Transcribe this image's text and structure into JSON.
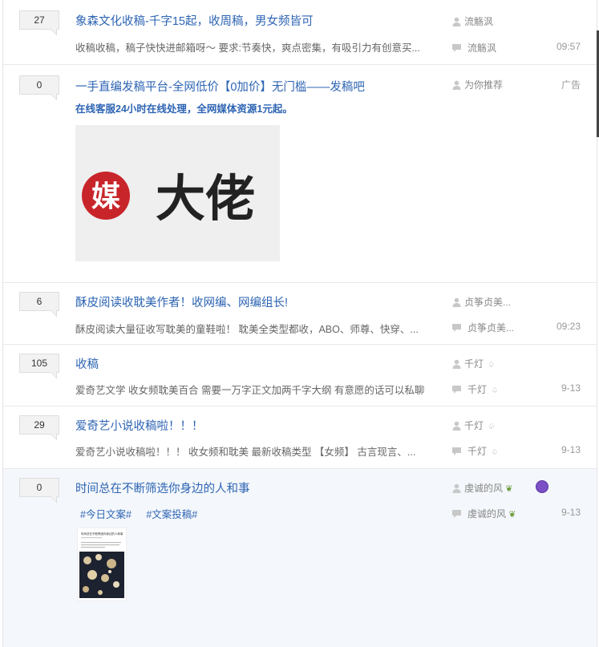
{
  "threads": [
    {
      "count": "27",
      "title": "象森文化收稿-千字15起，收周稿，男女频皆可",
      "abstract": "收稿收稿，稿子快快进邮箱呀～ 要求:节奏快，爽点密集，有吸引力有创意买...",
      "author": "流觞沨",
      "last_reply": "流觞沨",
      "time": "09:57"
    },
    {
      "count": "0",
      "title": "一手直编发稿平台-全网低价【0加价】无门槛——发稿吧",
      "promo": "在线客服24小时在线处理，全网媒体资源1元起。",
      "author": "为你推荐",
      "ad_label": "广告",
      "ad_logo_char": "媒",
      "ad_logo_text": "大佬"
    },
    {
      "count": "6",
      "title": "酥皮阅读收耽美作者！收网编、网编组长!",
      "abstract": "酥皮阅读大量征收写耽美的童鞋啦！ 耽美全类型都收，ABO、师尊、快穿、...",
      "author": "贞筝贞美...",
      "last_reply": "贞筝贞美...",
      "time": "09:23"
    },
    {
      "count": "105",
      "title": "收稿",
      "abstract": "爱奇艺文学 收女频耽美百合 需要一万字正文加两千字大纲 有意愿的话可以私聊",
      "author": "千灯",
      "last_reply": "千灯",
      "time": "9-13"
    },
    {
      "count": "29",
      "title": "爱奇艺小说收稿啦！！！",
      "abstract": "爱奇艺小说收稿啦！！！ 收女频和耽美 最新收稿类型 【女频】 古言现言、...",
      "author": "千灯",
      "last_reply": "千灯",
      "time": "9-13"
    },
    {
      "count": "0",
      "title": "时间总在不断筛选你身边的人和事",
      "tags": [
        "#今日文案#",
        "#文案投稿#"
      ],
      "author": "虔诚的风",
      "last_reply": "虔诚的风",
      "time": "9-13",
      "thumb_title": "时间总在不断筛选你身边的人和事"
    }
  ],
  "colors": {
    "link": "#2d64b3",
    "meta": "#888888",
    "badge_purple": "#7b4fc6"
  }
}
